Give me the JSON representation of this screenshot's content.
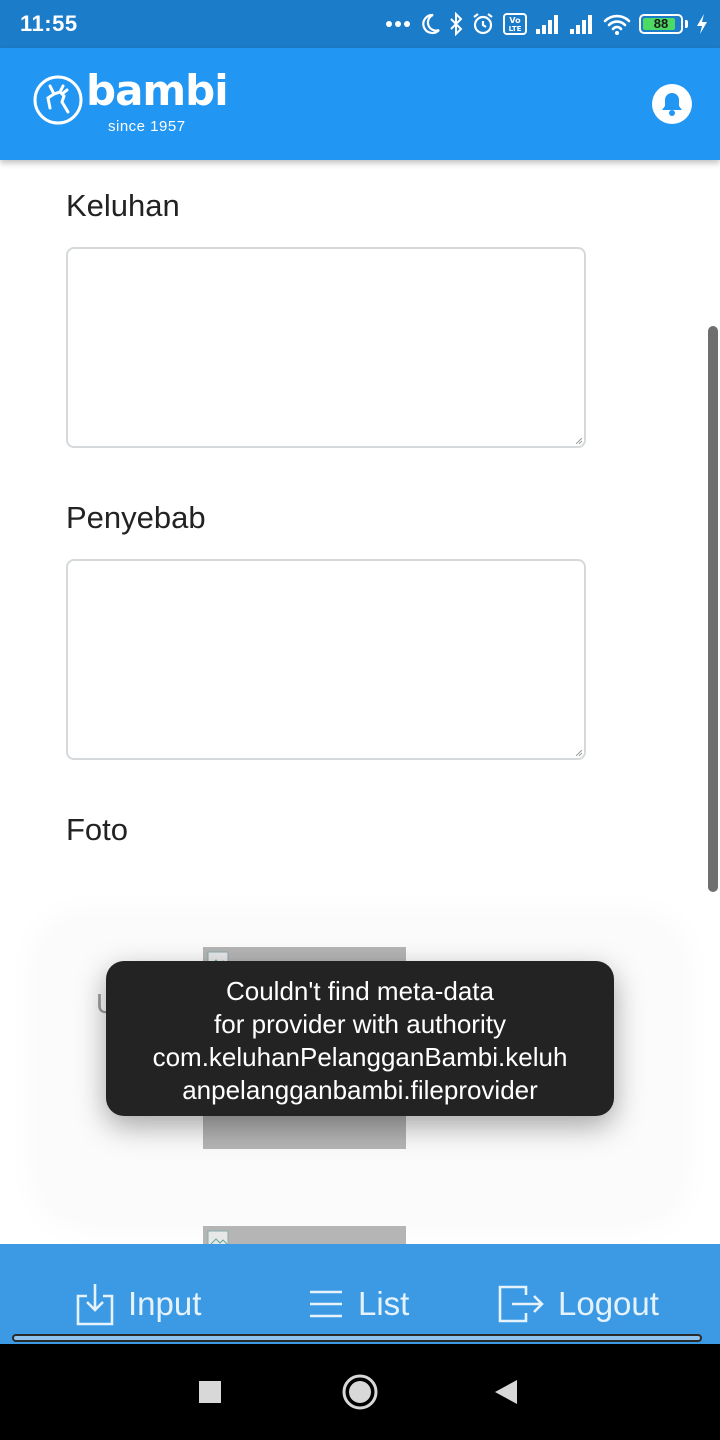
{
  "status_bar": {
    "time": "11:55",
    "battery": "88",
    "battery_level": 0.88,
    "icons": [
      "dots-icon",
      "moon-icon",
      "bluetooth-icon",
      "alarm-icon",
      "volte-icon",
      "signal-icon",
      "signal-icon",
      "wifi-icon",
      "battery-icon",
      "charging-icon"
    ]
  },
  "header": {
    "logo_text": "bambi",
    "logo_tagline": "since 1957",
    "notification_icon": "bell-icon"
  },
  "form": {
    "keluhan_label": "Keluhan",
    "keluhan_value": "",
    "penyebab_label": "Penyebab",
    "penyebab_value": "",
    "foto_label": "Foto",
    "upload_hint": "U"
  },
  "toast": {
    "lines": [
      "Couldn't find meta-data",
      "for provider with authority",
      "com.keluhanPelangganBambi.keluh",
      "anpelangganbambi.fileprovider"
    ]
  },
  "bottom_nav": {
    "items": [
      {
        "label": "Input",
        "icon": "download-icon"
      },
      {
        "label": "List",
        "icon": "menu-icon"
      },
      {
        "label": "Logout",
        "icon": "logout-icon"
      }
    ]
  },
  "system_nav": {
    "icons": [
      "recents-square-icon",
      "home-circle-icon",
      "back-triangle-icon"
    ]
  },
  "colors": {
    "status_bar": "#1b7cc9",
    "app_bar": "#2196f3",
    "bottom_nav": "#3b9ae3",
    "toast": "#232323"
  }
}
